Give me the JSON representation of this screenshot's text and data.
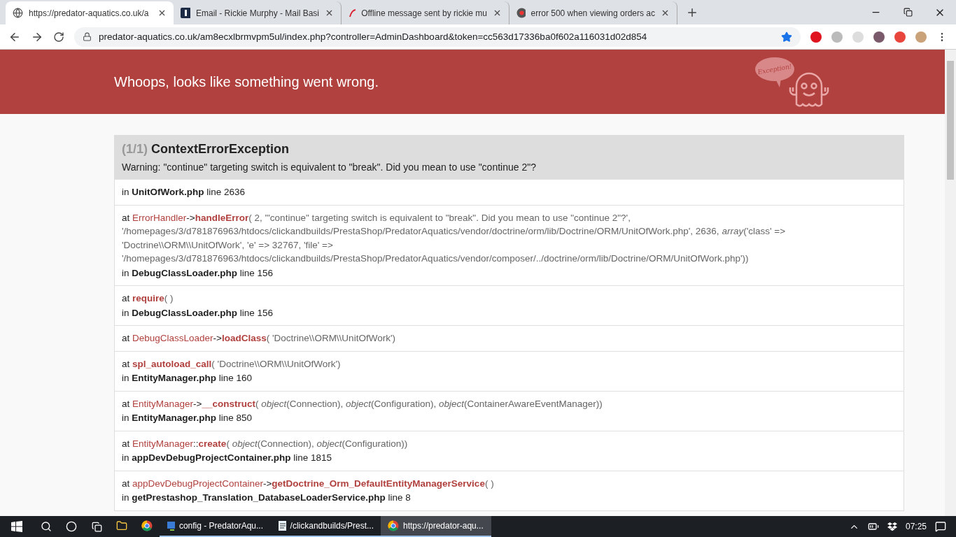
{
  "browser": {
    "tabs": [
      {
        "title": "https://predator-aquatics.co.uk/a",
        "kind": "globe",
        "selected": true
      },
      {
        "title": "Email - Rickie Murphy - Mail Basi",
        "kind": "square",
        "selected": false
      },
      {
        "title": "Offline message sent by rickie mu",
        "kind": "swoosh",
        "selected": false
      },
      {
        "title": "error 500 when viewing orders ac",
        "kind": "disc",
        "selected": false
      }
    ],
    "url": "predator-aquatics.co.uk/am8ecxlbrmvpm5ul/index.php?controller=AdminDashboard&token=cc563d17336ba0f602a116031d02d854",
    "bookmarked": true
  },
  "banner": {
    "title": "Whoops, looks like something went wrong.",
    "badge": "Exception!"
  },
  "exception": {
    "count": "(1/1)",
    "name": "ContextErrorException",
    "message": "Warning: \"continue\" targeting switch is equivalent to \"break\". Did you mean to use \"continue 2\"?",
    "trace": [
      {
        "location": "in **UnitOfWork.php** line 2636"
      },
      {
        "prefix": "at",
        "class": "ErrorHandler",
        "separator": "->",
        "function": "handleError",
        "args": "( 2, '\"continue\" targeting switch is equivalent to \"break\". Did you mean to use \"continue 2\"?', '/homepages/3/d781876963/htdocs/clickandbuilds/PrestaShop/PredatorAquatics/vendor/doctrine/orm/lib/Doctrine/ORM/UnitOfWork.php', 2636, *array*('class' => 'Doctrine\\\\ORM\\\\UnitOfWork', 'e' => 32767, 'file' => '/homepages/3/d781876963/htdocs/clickandbuilds/PrestaShop/PredatorAquatics/vendor/composer/../doctrine/orm/lib/Doctrine/ORM/UnitOfWork.php'))",
        "location": "in **DebugClassLoader.php** line 156"
      },
      {
        "prefix": "at",
        "function": "require",
        "args": "( )",
        "location": "in **DebugClassLoader.php** line 156"
      },
      {
        "prefix": "at",
        "class": "DebugClassLoader",
        "separator": "->",
        "function": "loadClass",
        "args": "( 'Doctrine\\\\ORM\\\\UnitOfWork')"
      },
      {
        "prefix": "at",
        "function": "spl_autoload_call",
        "args": "( 'Doctrine\\\\ORM\\\\UnitOfWork')",
        "location": "in **EntityManager.php** line 160"
      },
      {
        "prefix": "at",
        "class": "EntityManager",
        "separator": "->",
        "function": "__construct",
        "args": "( *object*(Connection), *object*(Configuration), *object*(ContainerAwareEventManager))",
        "location": "in **EntityManager.php** line 850"
      },
      {
        "prefix": "at",
        "class": "EntityManager",
        "separator": "::",
        "function": "create",
        "args": "( *object*(Connection), *object*(Configuration))",
        "location": "in **appDevDebugProjectContainer.php** line 1815"
      },
      {
        "prefix": "at",
        "class": "appDevDebugProjectContainer",
        "separator": "->",
        "function": "getDoctrine_Orm_DefaultEntityManagerService",
        "args": "( )",
        "location": "in **getPrestashop_Translation_DatabaseLoaderService.php** line 8"
      }
    ]
  },
  "taskbar": {
    "items": [
      {
        "kind": "folder",
        "selected": false
      },
      {
        "kind": "chrome",
        "selected": false
      },
      {
        "kind": "ftp",
        "label": "config - PredatorAqu...",
        "selected": false
      },
      {
        "kind": "notepad",
        "label": "/clickandbuilds/Prest...",
        "selected": false
      },
      {
        "kind": "chrome",
        "label": "https://predator-aqu...",
        "selected": true
      }
    ],
    "clock": "07:25"
  }
}
